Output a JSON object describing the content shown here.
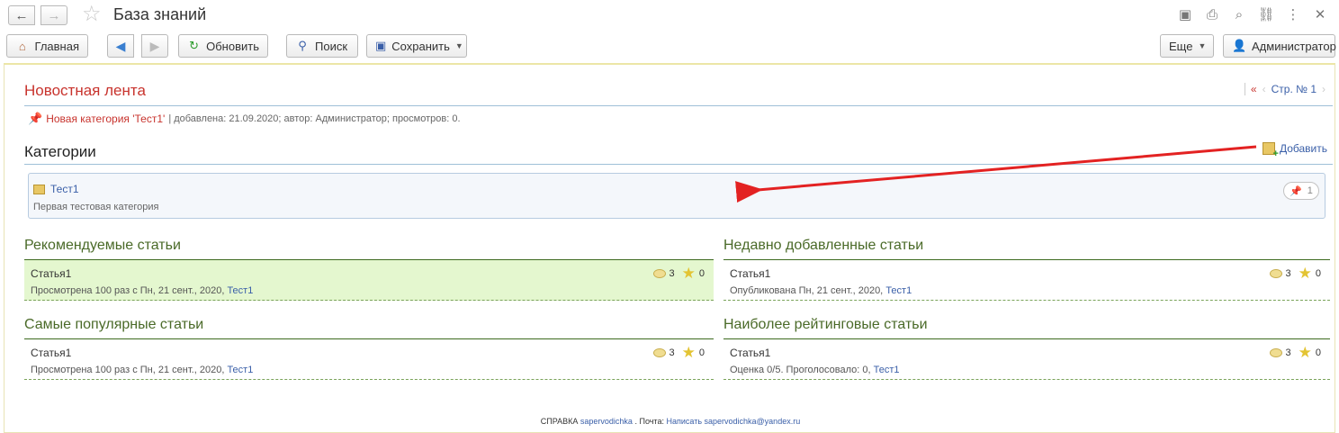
{
  "window": {
    "title": "База знаний",
    "icons": [
      "save-icon",
      "print-icon",
      "preview-icon",
      "link-icon",
      "more-icon",
      "close-icon"
    ]
  },
  "toolbar": {
    "home_label": "Главная",
    "refresh_label": "Обновить",
    "search_label": "Поиск",
    "save_label": "Сохранить",
    "more_label": "Еще",
    "user_label": "Администратор"
  },
  "news": {
    "heading": "Новостная лента",
    "pager_prev": "«",
    "pager_page": "Стр. № 1",
    "pager_next": "›",
    "item_link": "Новая категория 'Тест1'",
    "item_meta": "| добавлена: 21.09.2020; автор: Администратор; просмотров: 0."
  },
  "categories": {
    "heading": "Категории",
    "add_label": "Добавить",
    "items": [
      {
        "name": "Тест1",
        "description": "Первая тестовая категория",
        "count": "1"
      }
    ]
  },
  "sections": {
    "recommended": {
      "title": "Рекомендуемые статьи",
      "article": {
        "title": "Статья1",
        "meta": "Просмотрена 100 раз с Пн, 21 сент., 2020,",
        "category": "Тест1",
        "comments": "3",
        "rating": "0"
      }
    },
    "recent": {
      "title": "Недавно добавленные статьи",
      "article": {
        "title": "Статья1",
        "meta": "Опубликована Пн, 21 сент., 2020,",
        "category": "Тест1",
        "comments": "3",
        "rating": "0"
      }
    },
    "popular": {
      "title": "Самые популярные статьи",
      "article": {
        "title": "Статья1",
        "meta": "Просмотрена 100 раз с Пн, 21 сент., 2020,",
        "category": "Тест1",
        "comments": "3",
        "rating": "0"
      }
    },
    "top_rated": {
      "title": "Наиболее рейтинговые статьи",
      "article": {
        "title": "Статья1",
        "meta": "Оценка 0/5. Проголосовало: 0,",
        "category": "Тест1",
        "comments": "3",
        "rating": "0"
      }
    }
  },
  "footer": {
    "label": "СПРАВКА",
    "author": "sapervodichka",
    "mail_label": ". Почта:",
    "mail_link": "Написать sapervodichka@yandex.ru"
  },
  "colors": {
    "accent_red": "#c8332d",
    "link_blue": "#3a5fa8",
    "section_green": "#4a6a28",
    "highlight_green": "#e4f7cf"
  }
}
